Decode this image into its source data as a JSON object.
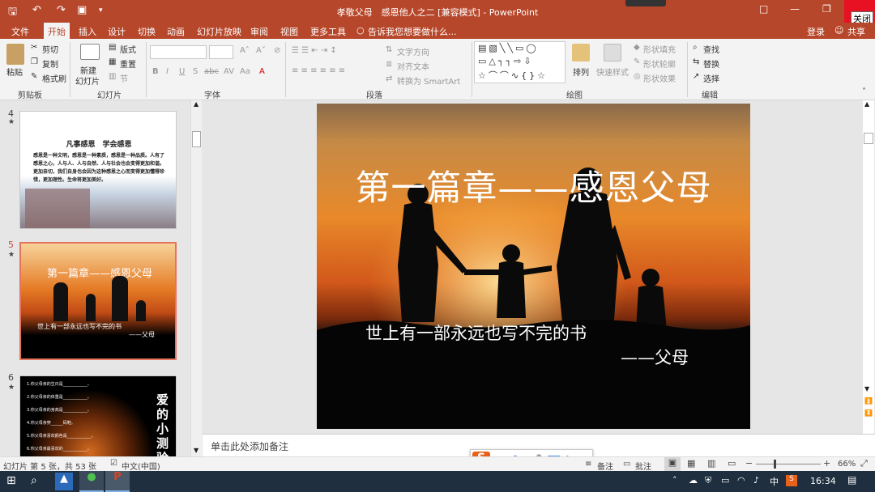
{
  "title_bar": {
    "title": "孝敬父母　感恩他人之二 [兼容模式] - PowerPoint",
    "close_tooltip": "关闭"
  },
  "menu": {
    "tabs": [
      "文件",
      "开始",
      "插入",
      "设计",
      "切换",
      "动画",
      "幻灯片放映",
      "审阅",
      "视图",
      "更多工具"
    ],
    "tell_me": "告诉我您想要做什么...",
    "login": "登录",
    "share": "共享"
  },
  "ribbon": {
    "clipboard": {
      "paste": "粘贴",
      "cut": "剪切",
      "copy": "复制",
      "format_painter": "格式刷",
      "group": "剪贴板"
    },
    "slides": {
      "new_slide_1": "新建",
      "new_slide_2": "幻灯片",
      "layout": "版式",
      "reset": "重置",
      "section": "节",
      "group": "幻灯片"
    },
    "font": {
      "group": "字体",
      "bold": "B",
      "italic": "I",
      "underline": "U",
      "strike": "S",
      "shadow": "abc",
      "spacing": "AV",
      "case": "Aa"
    },
    "paragraph": {
      "group": "段落",
      "text_direction": "文字方向",
      "align_text": "对齐文本",
      "smartart": "转换为 SmartArt"
    },
    "drawing": {
      "group": "绘图",
      "arrange": "排列",
      "quick_styles": "快速样式",
      "shape_fill": "形状填充",
      "shape_outline": "形状轮廓",
      "shape_effects": "形状效果"
    },
    "editing": {
      "group": "编辑",
      "find": "查找",
      "replace": "替换",
      "select": "选择"
    }
  },
  "thumbnails": [
    {
      "num": "4",
      "title": "凡事感恩　学会感恩",
      "body": "感恩是一种文明，感恩是一种素质，感恩是一种品质。人有了感恩之心，人与人、人与自然、人与社会也会变得更加和谐。更加亲切，我们自身也会因为这种感恩之心而变得更加懂得珍惜，更加理性。生命将更加美好。"
    },
    {
      "num": "5",
      "title": "第一篇章——感恩父母",
      "line1": "世上有一部永远也写不完的书",
      "line2": "——父母"
    },
    {
      "num": "6",
      "items": [
        "1.你父母亲的生日是____________。",
        "2.你父母亲的体重是____________。",
        "3.你父母亲的身高是____________。",
        "4.你父母亲穿______码鞋。",
        "5.你父母亲喜欢颜色是____________。",
        "6.你父母亲最喜欢的____________。"
      ],
      "side_title": "爱的小测验"
    }
  ],
  "slide": {
    "title": "第一篇章——感恩父母",
    "line1": "世上有一部永远也写不完的书",
    "line2": "——父母"
  },
  "notes_placeholder": "单击此处添加备注",
  "status": {
    "slide_info": "幻灯片 第 5 张，共 53 张",
    "language": "中文(中国)",
    "notes": "备注",
    "comments": "批注",
    "zoom": "66%"
  },
  "ime": {
    "lang": "中"
  },
  "taskbar": {
    "tray_lang": "中",
    "time": "16:34"
  },
  "colors": {
    "accent": "#b7472a",
    "taskbar": "#1f2f3f",
    "close": "#e81123"
  }
}
